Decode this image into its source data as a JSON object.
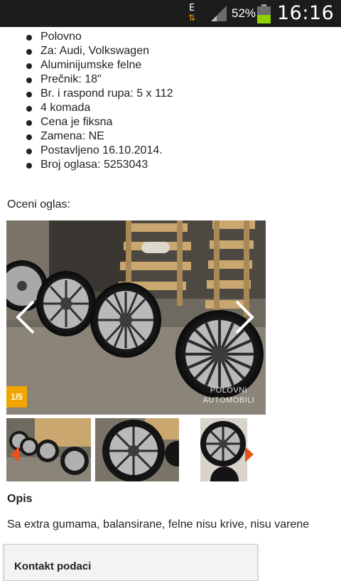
{
  "status_bar": {
    "network_type": "E",
    "battery_percent": "52%",
    "battery_level": 0.52,
    "time": "16:16"
  },
  "details": [
    "Polovno",
    "Za: Audi, Volkswagen",
    "Aluminijumske felne",
    "Prečnik: 18\"",
    "Br. i raspond rupa: 5 x 112",
    "4 komada",
    "Cena je fiksna",
    "Zamena: NE",
    "Postavljeno 16.10.2014.",
    "Broj oglasa: 5253043"
  ],
  "rate_label": "Oceni oglas:",
  "gallery": {
    "counter": "1/5",
    "watermark_line1": "POLOVNI",
    "watermark_line2": "AUTOMOBILI"
  },
  "colors": {
    "accent": "#f0a500",
    "status_bar": "#1c1c1c",
    "battery": "#8fd400"
  },
  "description_title": "Opis",
  "description_text": "Sa extra gumama, balansirane, felne nisu krive, nisu varene",
  "contact_title": "Kontakt podaci"
}
